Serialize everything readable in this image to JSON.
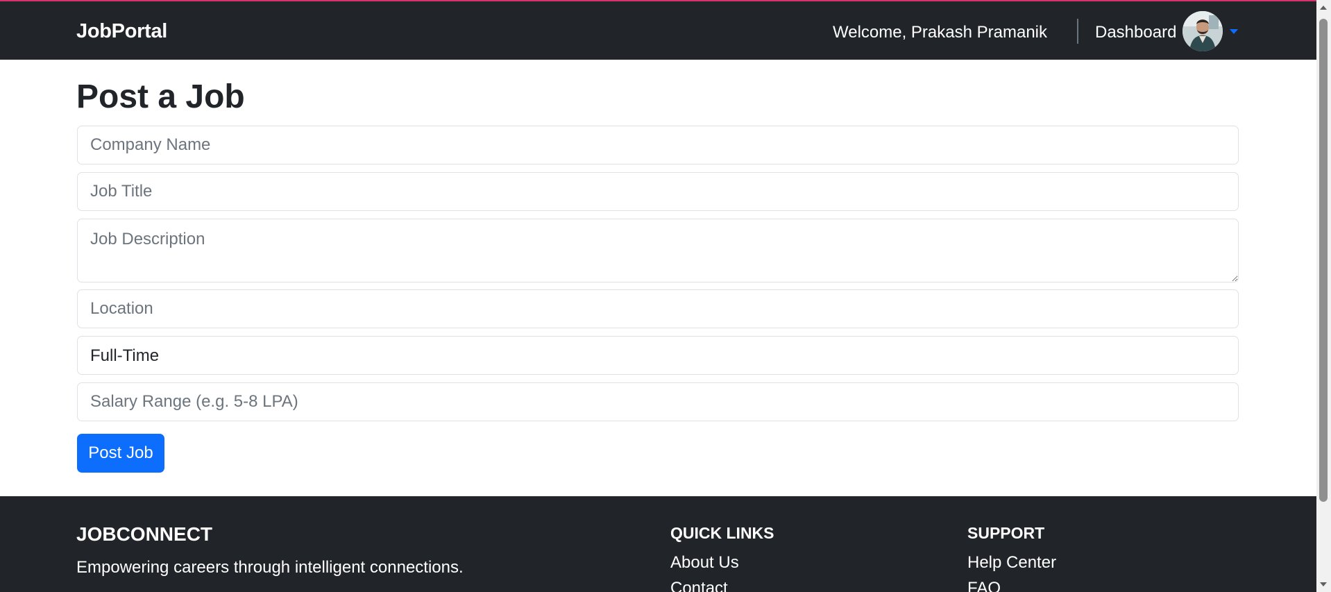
{
  "navbar": {
    "brand": "JobPortal",
    "welcome": "Welcome, Prakash Pramanik",
    "dashboard_label": "Dashboard",
    "avatar_icon": "user-avatar-photo",
    "caret_icon": "caret-down-icon"
  },
  "main": {
    "title": "Post a Job",
    "form": {
      "company_placeholder": "Company Name",
      "title_placeholder": "Job Title",
      "description_placeholder": "Job Description",
      "location_placeholder": "Location",
      "job_type_options": [
        "Full-Time"
      ],
      "salary_placeholder": "Salary Range (e.g. 5-8 LPA)",
      "submit_label": "Post Job"
    }
  },
  "footer": {
    "brand": "JOBCONNECT",
    "tagline": "Empowering careers through intelligent connections.",
    "quick_links": {
      "heading": "QUICK LINKS",
      "items": [
        "About Us",
        "Contact"
      ]
    },
    "support": {
      "heading": "SUPPORT",
      "items": [
        "Help Center",
        "FAQ"
      ]
    }
  },
  "colors": {
    "navbar_bg": "#212529",
    "accent": "#0d6efd",
    "top_border": "#d6336c"
  }
}
